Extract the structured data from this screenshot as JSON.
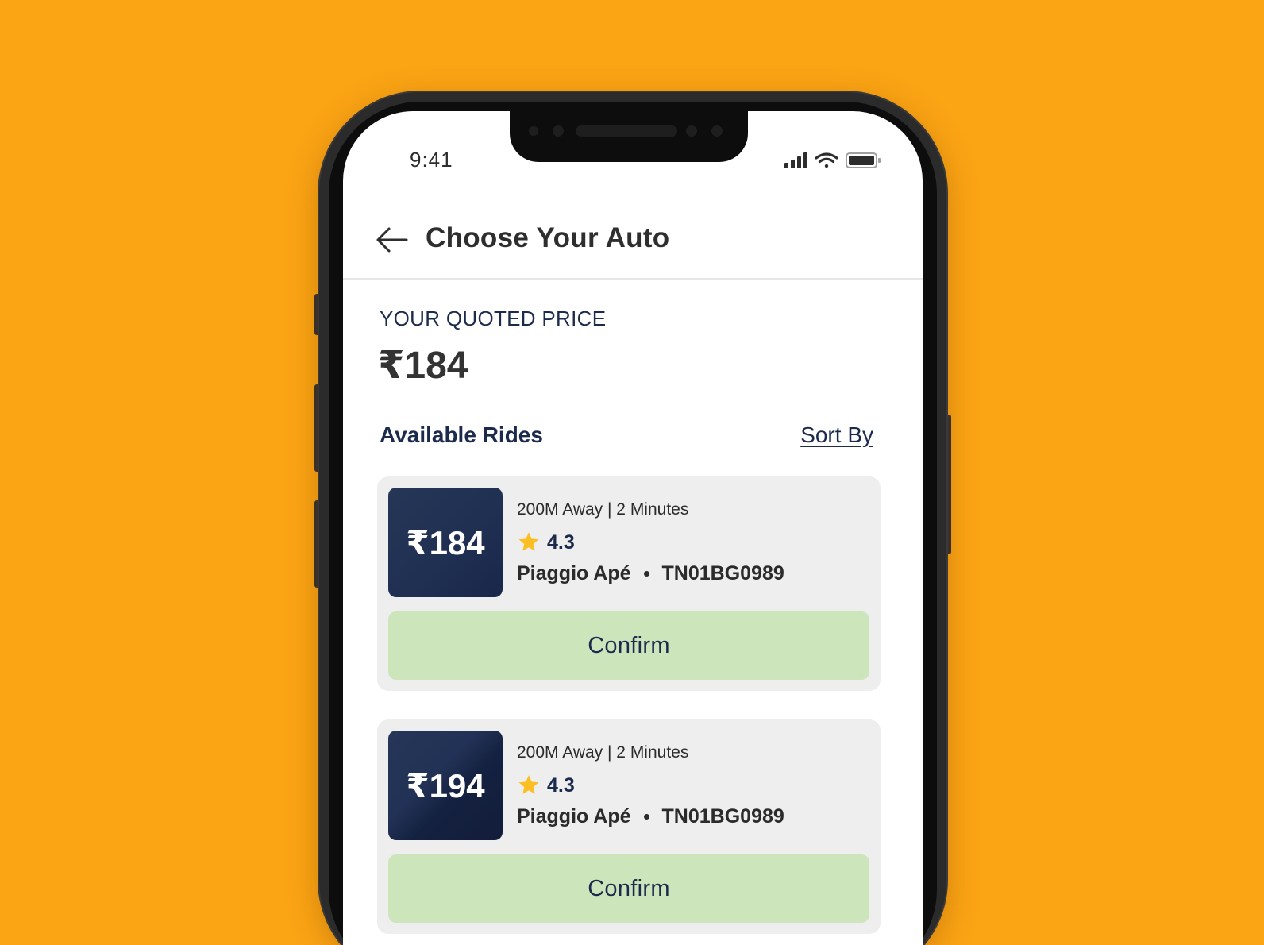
{
  "status_bar": {
    "time": "9:41"
  },
  "header": {
    "title": "Choose Your Auto",
    "back_icon": "arrow-left-icon"
  },
  "quote": {
    "label": "YOUR QUOTED PRICE",
    "price": "₹184"
  },
  "rides_section": {
    "title": "Available Rides",
    "sort_label": "Sort By"
  },
  "rides": [
    {
      "price": "₹184",
      "meta": "200M Away | 2 Minutes",
      "rating": "4.3",
      "vehicle": "Piaggio Apé",
      "plate": "TN01BG0989",
      "confirm_label": "Confirm"
    },
    {
      "price": "₹194",
      "meta": "200M Away | 2 Minutes",
      "rating": "4.3",
      "vehicle": "Piaggio Apé",
      "plate": "TN01BG0989",
      "confirm_label": "Confirm"
    }
  ],
  "colors": {
    "background": "#FBA414",
    "price_tile": "#203052",
    "confirm_button": "#CCE5BB",
    "card": "#EFEEEF",
    "star": "#FBBF24"
  }
}
